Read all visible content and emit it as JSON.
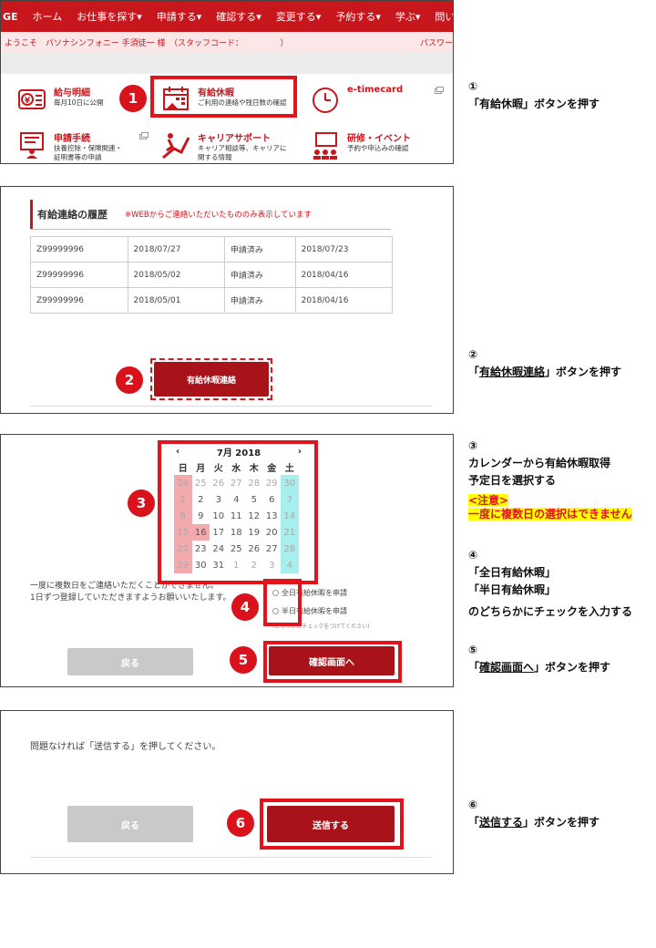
{
  "panel1": {
    "nav_items": [
      "GE",
      "ホーム",
      "お仕事を探す▾",
      "申請する▾",
      "確認する▾",
      "変更する▾",
      "予約する▾",
      "学ぶ▾",
      "問い"
    ],
    "welcome": "ようこそ　パソナシンフォニー 手須徒一 様　（スタッフコード：　　　　　）",
    "welcome_right": "パスワー",
    "tiles": [
      {
        "title": "給与明細",
        "desc": "毎月10日に公開"
      },
      {
        "title": "有給休暇",
        "desc": "ご利用の連絡や残日数の確認"
      },
      {
        "title": "e-timecard",
        "desc": ""
      },
      {
        "title": "申請手続",
        "desc": "扶養控除・保険関連・証明書等の申請"
      },
      {
        "title": "キャリアサポート",
        "desc": "キャリア相談等、キャリアに関する情報"
      },
      {
        "title": "研修・イベント",
        "desc": "予約や申込みの確認"
      }
    ],
    "step": "1"
  },
  "panel2": {
    "title": "有給連絡の履歴",
    "note": "※WEBからご連絡いただいたもののみ表示しています",
    "rows": [
      [
        "Z99999996",
        "2018/07/27",
        "申請済み",
        "2018/07/23"
      ],
      [
        "Z99999996",
        "2018/05/02",
        "申請済み",
        "2018/04/16"
      ],
      [
        "Z99999996",
        "2018/05/01",
        "申請済み",
        "2018/04/16"
      ]
    ],
    "button": "有給休暇連絡",
    "step": "2"
  },
  "panel3": {
    "month": "7月 2018",
    "prev": "‹",
    "next": "›",
    "weekdays": [
      "日",
      "月",
      "火",
      "水",
      "木",
      "金",
      "土"
    ],
    "days": [
      "24",
      "25",
      "26",
      "27",
      "28",
      "29",
      "30",
      "1",
      "2",
      "3",
      "4",
      "5",
      "6",
      "7",
      "8",
      "9",
      "10",
      "11",
      "12",
      "13",
      "14",
      "15",
      "16",
      "17",
      "18",
      "19",
      "20",
      "21",
      "22",
      "23",
      "24",
      "25",
      "26",
      "27",
      "28",
      "29",
      "30",
      "31",
      "1",
      "2",
      "3",
      "4"
    ],
    "note_line1": "一度に複数日をご連絡いただくことができません。",
    "note_line2": "1日ずつ登録していただきますようお願いいたします。",
    "check_full": "全日有給休暇を申請",
    "check_half": "半日有給休暇を申請",
    "check_hint": "(どちらかにチェックをつけてください)",
    "back": "戻る",
    "confirm": "確認画面へ",
    "step_cal": "3",
    "step_check": "4",
    "step_confirm": "5"
  },
  "panel4": {
    "text": "問題なければ「送信する」を押してください。",
    "back": "戻る",
    "send": "送信する",
    "step": "6"
  },
  "instructions": {
    "s1_num": "①",
    "s1_pre": "「",
    "s1_u": "有給休暇",
    "s1_post": "」ボタンを押す",
    "s2_num": "②",
    "s2_pre": "「",
    "s2_u": "有給休暇連絡",
    "s2_post": "」ボタンを押す",
    "s3_num": "③",
    "s3_l1": "カレンダーから有給休暇取得",
    "s3_l2": "予定日を選択する",
    "warn_title": "<注意>",
    "warn_text": "一度に複数日の選択はできません",
    "s4_num": "④",
    "s4_l1": "「全日有給休暇」",
    "s4_l2": "「半日有給休暇」",
    "s4_l3": "のどちらかにチェックを入力する",
    "s5_num": "⑤",
    "s5_pre": "「",
    "s5_u": "確認画面へ",
    "s5_post": "」ボタンを押す",
    "s6_num": "⑥",
    "s6_pre": "「",
    "s6_u": "送信する",
    "s6_post": "」ボタンを押す"
  },
  "colors": {
    "brand_red": "#c8161d",
    "highlight": "#e3121b",
    "sun": "#f4a9ad",
    "sat": "#a7efef",
    "warn_bg": "#ffff00"
  }
}
